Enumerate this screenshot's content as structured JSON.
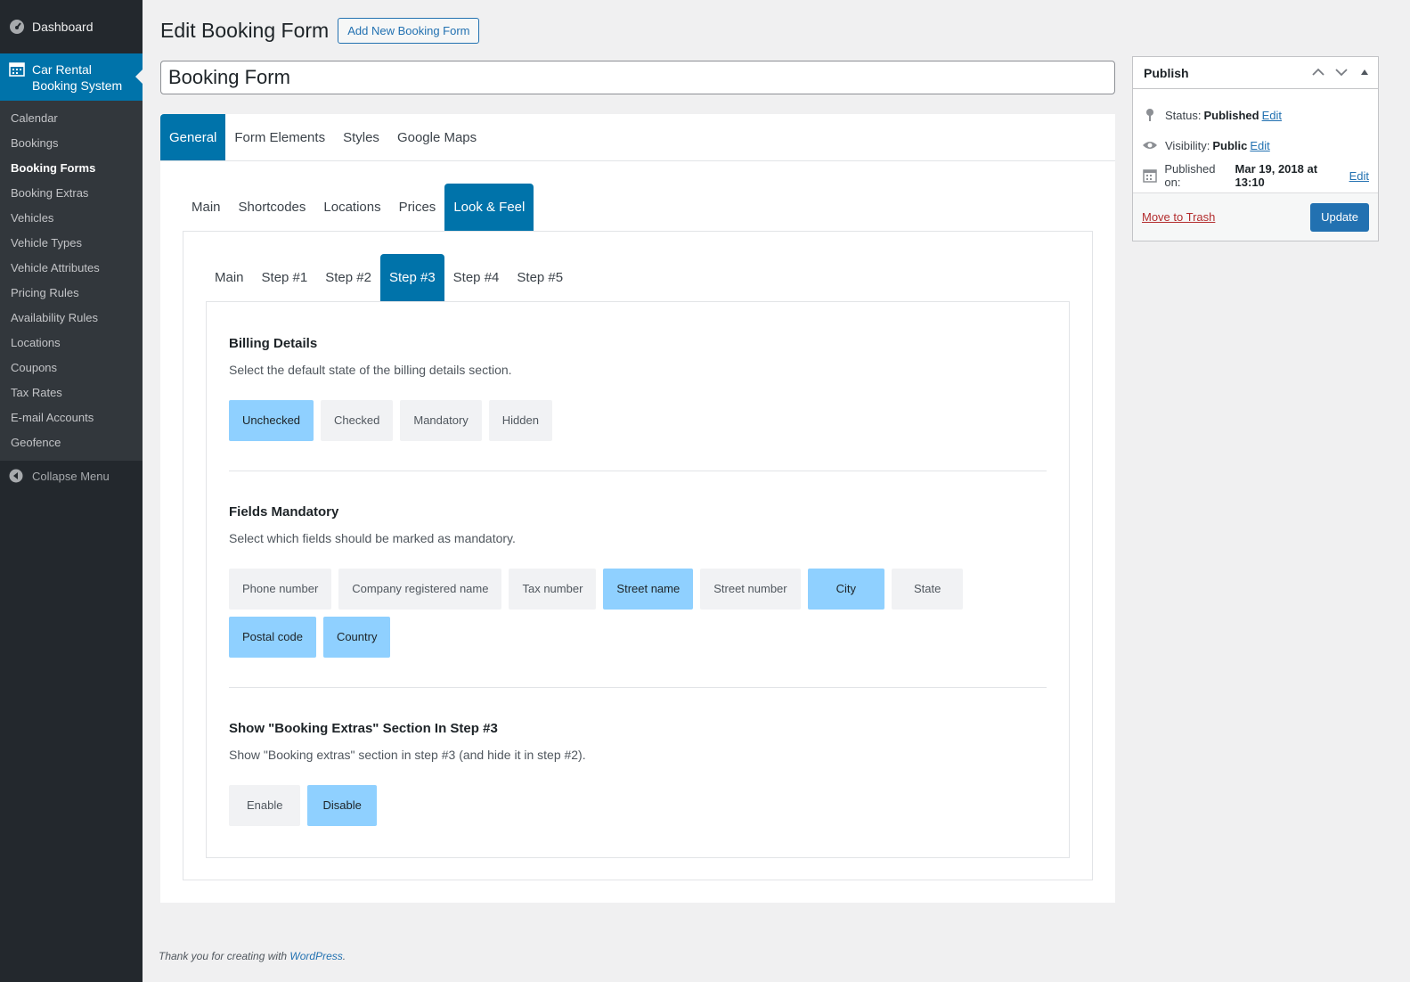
{
  "sidebar": {
    "dashboard": "Dashboard",
    "active_menu": "Car Rental Booking System",
    "items": [
      {
        "label": "Calendar"
      },
      {
        "label": "Bookings"
      },
      {
        "label": "Booking Forms"
      },
      {
        "label": "Booking Extras"
      },
      {
        "label": "Vehicles"
      },
      {
        "label": "Vehicle Types"
      },
      {
        "label": "Vehicle Attributes"
      },
      {
        "label": "Pricing Rules"
      },
      {
        "label": "Availability Rules"
      },
      {
        "label": "Locations"
      },
      {
        "label": "Coupons"
      },
      {
        "label": "Tax Rates"
      },
      {
        "label": "E-mail Accounts"
      },
      {
        "label": "Geofence"
      }
    ],
    "current_item": "Booking Forms",
    "collapse": "Collapse Menu"
  },
  "header": {
    "title": "Edit Booking Form",
    "add_new": "Add New Booking Form",
    "form_title_value": "Booking Form"
  },
  "tabs_level1": [
    "General",
    "Form Elements",
    "Styles",
    "Google Maps"
  ],
  "tabs_level1_active": "General",
  "tabs_level2": [
    "Main",
    "Shortcodes",
    "Locations",
    "Prices",
    "Look & Feel"
  ],
  "tabs_level2_active": "Look & Feel",
  "tabs_level3": [
    "Main",
    "Step #1",
    "Step #2",
    "Step #3",
    "Step #4",
    "Step #5"
  ],
  "tabs_level3_active": "Step #3",
  "sections": {
    "billing": {
      "title": "Billing Details",
      "desc": "Select the default state of the billing details section.",
      "options": [
        {
          "label": "Unchecked",
          "selected": true
        },
        {
          "label": "Checked",
          "selected": false
        },
        {
          "label": "Mandatory",
          "selected": false
        },
        {
          "label": "Hidden",
          "selected": false
        }
      ]
    },
    "mandatory": {
      "title": "Fields Mandatory",
      "desc": "Select which fields should be marked as mandatory.",
      "options": [
        {
          "label": "Phone number",
          "selected": false
        },
        {
          "label": "Company registered name",
          "selected": false
        },
        {
          "label": "Tax number",
          "selected": false
        },
        {
          "label": "Street name",
          "selected": true
        },
        {
          "label": "Street number",
          "selected": false
        },
        {
          "label": "City",
          "selected": true
        },
        {
          "label": "State",
          "selected": false
        },
        {
          "label": "Postal code",
          "selected": true
        },
        {
          "label": "Country",
          "selected": true
        }
      ]
    },
    "extras": {
      "title": "Show \"Booking Extras\" Section In Step #3",
      "desc": "Show \"Booking extras\" section in step #3 (and hide it in step #2).",
      "options": [
        {
          "label": "Enable",
          "selected": false
        },
        {
          "label": "Disable",
          "selected": true
        }
      ]
    }
  },
  "publish": {
    "title": "Publish",
    "status_label": "Status:",
    "status_value": "Published",
    "visibility_label": "Visibility:",
    "visibility_value": "Public",
    "published_label": "Published on:",
    "published_value": "Mar 19, 2018 at 13:10",
    "edit": "Edit",
    "trash": "Move to Trash",
    "update": "Update"
  },
  "footer": {
    "text": "Thank you for creating with",
    "link": "WordPress",
    "period": "."
  },
  "colors": {
    "sidebar_bg": "#23282d",
    "accent": "#0073aa",
    "selected_option": "#8fd0ff",
    "unselected_option": "#f1f2f4"
  }
}
